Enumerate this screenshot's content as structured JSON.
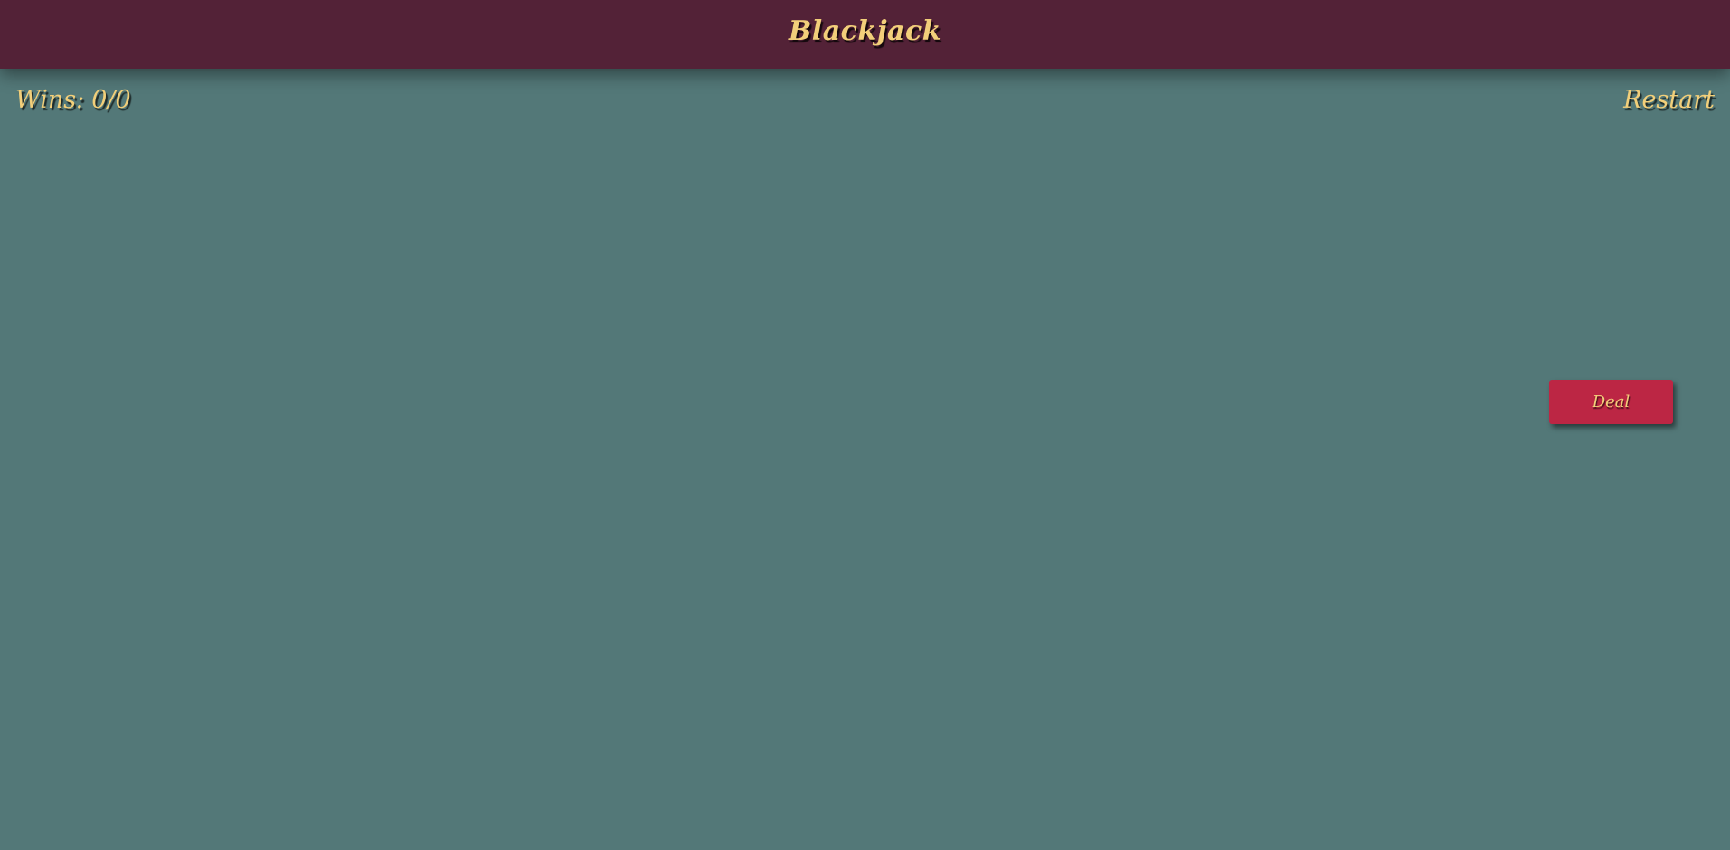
{
  "header": {
    "title": "Blackjack"
  },
  "score": {
    "label": "Wins:",
    "value": "0/0"
  },
  "controls": {
    "restart_label": "Restart",
    "deal_label": "Deal"
  },
  "colors": {
    "background": "#537878",
    "header": "#532237",
    "text_gold": "#f2cf7a",
    "deal_button": "#bc2644"
  }
}
